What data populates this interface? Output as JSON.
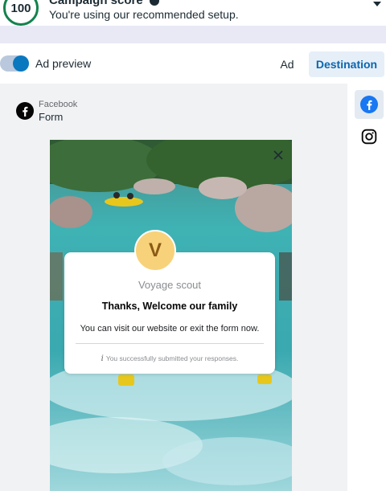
{
  "campaign_score": {
    "score": "100",
    "title": "Campaign score",
    "subtitle": "You're using our recommended setup.",
    "info_icon": "info-icon",
    "expand_icon": "chevron-down-icon",
    "ring_color": "#13824d"
  },
  "toolbar": {
    "toggle_label": "Ad preview",
    "toggle_on": true,
    "tabs": [
      {
        "label": "Ad",
        "selected": false
      },
      {
        "label": "Destination",
        "selected": true
      }
    ]
  },
  "preview": {
    "platform_name": "Facebook",
    "placement": "Form",
    "platforms": [
      {
        "icon": "facebook-icon",
        "selected": true
      },
      {
        "icon": "instagram-icon",
        "selected": false
      }
    ]
  },
  "form_card": {
    "avatar_letter": "V",
    "brand": "Voyage scout",
    "heading": "Thanks, Welcome our family",
    "body": "You can visit our website or exit the form now.",
    "note_icon": "i",
    "note": "You successfully submitted your responses.",
    "close_icon": "close-icon"
  },
  "colors": {
    "accent": "#0a78be",
    "destination_tab_bg": "#e6eff8",
    "avatar_bg": "#f8d27a"
  }
}
